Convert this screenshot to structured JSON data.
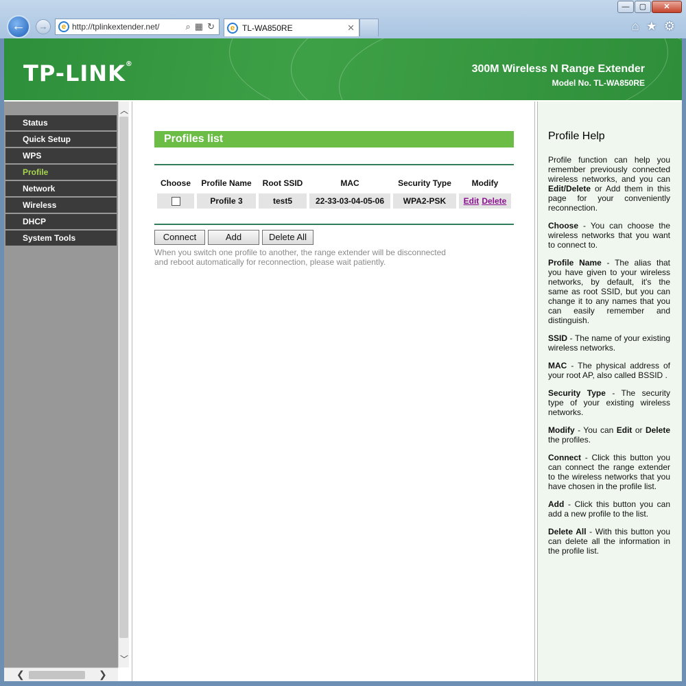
{
  "browser": {
    "url": "http://tplinkextender.net/",
    "tab_title": "TL-WA850RE",
    "tab_close": "✕",
    "win_minimize": "—",
    "win_maximize": "▢",
    "win_close": "✕"
  },
  "header": {
    "logo": "TP-LINK",
    "product": "300M Wireless N Range Extender",
    "model": "Model No. TL-WA850RE",
    "brand_color": "#3ea046"
  },
  "sidebar": {
    "items": [
      {
        "label": "Status"
      },
      {
        "label": "Quick Setup"
      },
      {
        "label": "WPS"
      },
      {
        "label": "Profile",
        "active": true
      },
      {
        "label": "Network"
      },
      {
        "label": "Wireless"
      },
      {
        "label": "DHCP"
      },
      {
        "label": "System Tools"
      }
    ],
    "active_color": "#a6d54e"
  },
  "main": {
    "title": "Profiles list",
    "columns": [
      "Choose",
      "Profile Name",
      "Root SSID",
      "MAC",
      "Security Type",
      "Modify"
    ],
    "rows": [
      {
        "profile_name": "Profile 3",
        "root_ssid": "test5",
        "mac": "22-33-03-04-05-06",
        "security": "WPA2-PSK",
        "edit": "Edit",
        "delete": "Delete"
      }
    ],
    "buttons": {
      "connect": "Connect",
      "add": "Add",
      "delete_all": "Delete All"
    },
    "note": "When you switch one profile to another, the range extender will be disconnected and reboot automatically for reconnection, please wait patiently."
  },
  "help": {
    "title": "Profile Help",
    "intro_1": "Profile function can help you remember previously connected wireless networks, and you can",
    "intro_bold": "Edit/Delete",
    "intro_2": "or Add them in this page for your conveniently reconnection.",
    "entries": [
      {
        "term": "Choose",
        "text": " - You can choose the wireless networks that you want to connect to."
      },
      {
        "term": "Profile Name",
        "text": " - The alias that you have given to your wireless networks, by default, it's the same as root SSID, but you can change it to any names that you can easily remember and distinguish."
      },
      {
        "term": "SSID",
        "text": " - The name of your existing wireless networks."
      },
      {
        "term": "MAC",
        "text": " - The physical address of your root AP, also called BSSID ."
      },
      {
        "term": "Security Type",
        "text": " - The security type of your existing wireless networks."
      },
      {
        "term": "Connect",
        "text": " - Click this button you can connect the range extender to the wireless networks that you have chosen in the profile list."
      },
      {
        "term": "Add",
        "text": " - Click this button you can add a new profile to the list."
      },
      {
        "term": "Delete All",
        "text": " - With this button you can delete all the information in the profile list."
      }
    ],
    "modify_term": "Modify",
    "modify_1": " - You can ",
    "modify_edit": "Edit",
    "modify_or": " or ",
    "modify_delete": "Delete",
    "modify_2": " the profiles."
  }
}
